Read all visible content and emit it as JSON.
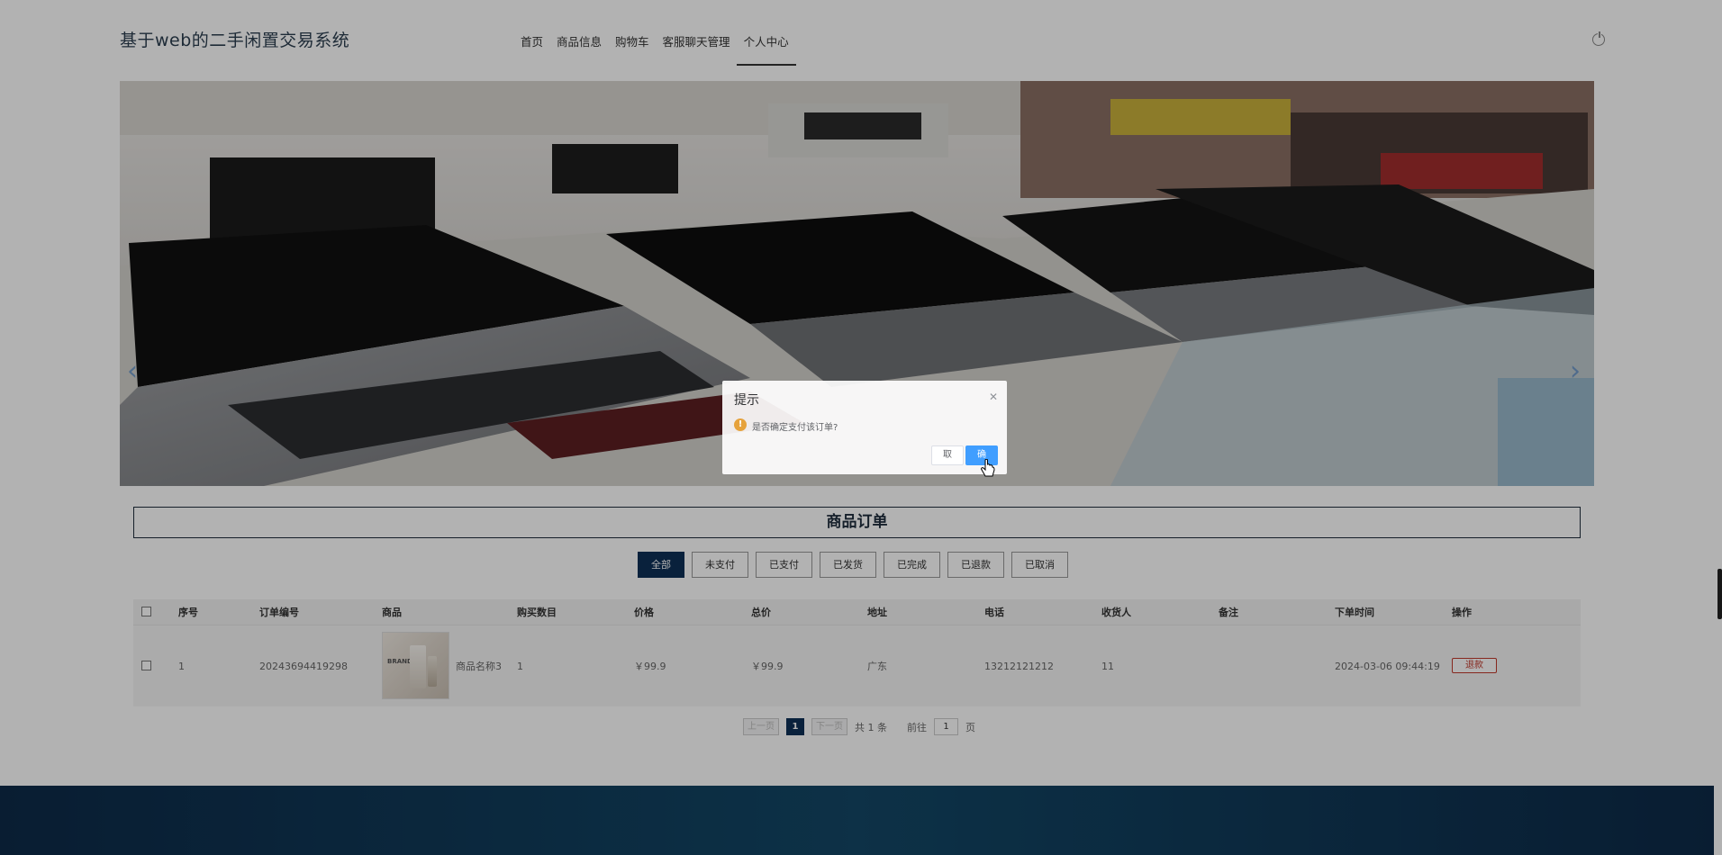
{
  "header": {
    "site_title": "基于web的二手闲置交易系统",
    "nav": [
      "首页",
      "商品信息",
      "购物车",
      "客服聊天管理",
      "个人中心"
    ],
    "active_nav": "个人中心"
  },
  "banner": {
    "prev_icon": "chevron-left-icon",
    "next_icon": "chevron-right-icon",
    "slide_count": 3,
    "active_slide": 1
  },
  "orders": {
    "section_title": "商品订单",
    "filters": [
      "全部",
      "未支付",
      "已支付",
      "已发货",
      "已完成",
      "已退款",
      "已取消"
    ],
    "active_filter": "全部",
    "columns": [
      "序号",
      "订单编号",
      "商品",
      "购买数目",
      "价格",
      "总价",
      "地址",
      "电话",
      "收货人",
      "备注",
      "下单时间",
      "操作"
    ],
    "rows": [
      {
        "index": "1",
        "order_no": "20243694419298",
        "product_name": "商品名称3",
        "quantity": "1",
        "price": "￥99.9",
        "total": "￥99.9",
        "address": "广东",
        "phone": "13212121212",
        "receiver": "11",
        "remark": "",
        "order_time": "2024-03-06 09:44:19",
        "action": "退款",
        "thumb_brand": "BRAND"
      }
    ]
  },
  "pagination": {
    "prev": "上一页",
    "current": "1",
    "next": "下一页",
    "total": "共 1 条",
    "goto_label": "前往",
    "goto_value": "1",
    "page_unit": "页"
  },
  "dialog": {
    "title": "提示",
    "message": "是否确定支付该订单?",
    "cancel": "取",
    "confirm": "确",
    "close_icon": "close-icon",
    "warning_icon": "warning-icon"
  },
  "colors": {
    "primary": "#0d3057",
    "dialog_accent": "#409eff",
    "warning": "#e6a23c",
    "refund": "#c0392b"
  }
}
